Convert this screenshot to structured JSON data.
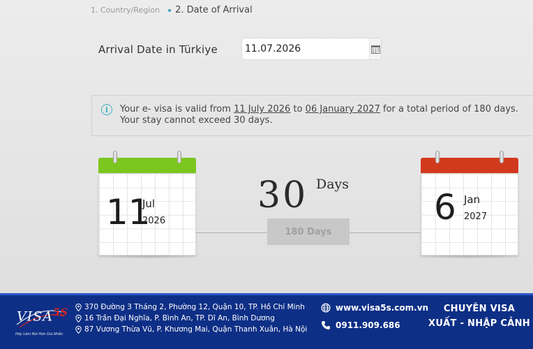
{
  "steps": {
    "step1": "1. Country/Region",
    "step2": "2. Date of Arrival"
  },
  "arrival": {
    "label": "Arrival Date in Türkiye",
    "value": "11.07.2026"
  },
  "info": {
    "text_prefix": "Your e- visa is valid from ",
    "valid_from": "11 July 2026",
    "text_to": " to ",
    "valid_to": "06 January 2027",
    "text_suffix": " for a total period of 180 days. Your stay cannot exceed 30 days."
  },
  "stay": {
    "number": "30",
    "unit": "Days",
    "total": "180 Days"
  },
  "start_calendar": {
    "day": "11",
    "month": "Jul",
    "year": "2026",
    "color": "#7cc620"
  },
  "end_calendar": {
    "day": "6",
    "month": "Jan",
    "year": "2027",
    "color": "#d23a1e"
  },
  "footer": {
    "logo_text": "VISA",
    "logo_accent": "5S",
    "logo_slogan": "Hãy Làm Nơi Hơn Gia Nhân",
    "addresses": [
      "370 Đường 3 Tháng 2, Phường 12, Quận 10, TP. Hồ Chí Minh",
      "16 Trần Đại Nghĩa, P. Bình An, TP. Dĩ An, Bình Dương",
      "87 Vương Thừa Vũ, P. Khương Mai, Quận Thanh Xuân, Hà Nội"
    ],
    "website": "www.visa5s.com.vn",
    "phone": "0911.909.686",
    "slogan_line1": "CHUYÊN VISA",
    "slogan_line2": "XUẤT - NHẬP CẢNH",
    "background_color": "#0e2f86"
  }
}
